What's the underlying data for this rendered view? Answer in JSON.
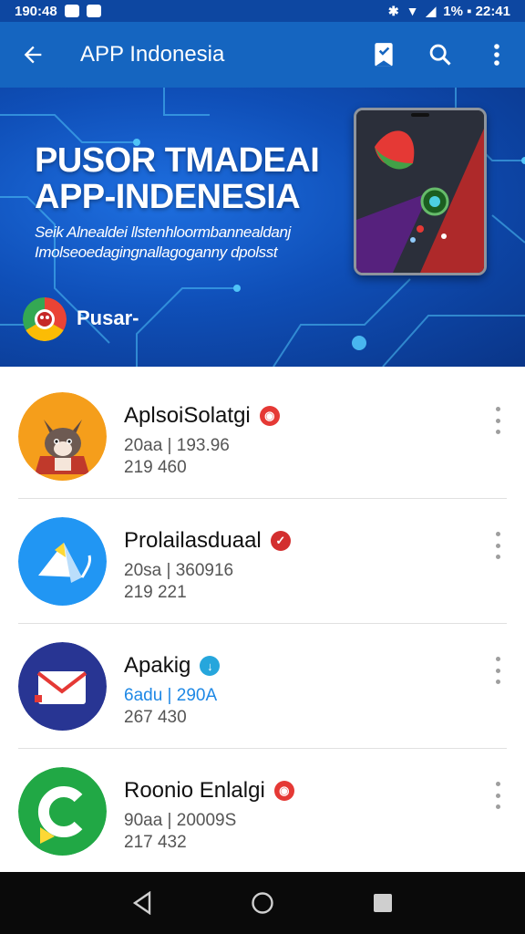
{
  "status_bar": {
    "time": "190:48",
    "right_text": "1% ▪ 22:41"
  },
  "app_bar": {
    "title": "APP Indonesia",
    "icons": [
      "back-arrow-icon",
      "bookmark-icon",
      "search-icon",
      "more-vert-icon"
    ]
  },
  "banner": {
    "title": "PUSOR TMADEAI\nAPP-INDENESIA",
    "subtitle": "Seik Alnealdei llstenhloormbannealdanj\nImolseoedagingnallagoganny dpolsst",
    "brand": "Pusar-"
  },
  "apps": [
    {
      "name": "AplsoiSolatgi",
      "meta1": "20aa | 193.96",
      "meta2": "219 460",
      "badge_color": "#e53935",
      "badge_glyph": "◉",
      "icon": "fox-mascot-icon"
    },
    {
      "name": "Prolailasduaal",
      "meta1": "20sa | 360916",
      "meta2": "219 221",
      "badge_color": "#d32f2f",
      "badge_glyph": "✓",
      "icon": "paper-plane-icon"
    },
    {
      "name": "Apakig",
      "meta1": "6adu | 290A",
      "meta2": "267 430",
      "badge_color": "#1e88e5",
      "badge_glyph": "↓",
      "icon": "mail-icon"
    },
    {
      "name": "Roonio Enlalgi",
      "meta1": "90aa | 20009S",
      "meta2": "217 432",
      "badge_color": "#e53935",
      "badge_glyph": "◉",
      "icon": "refresh-c-icon"
    }
  ],
  "colors": {
    "app_bar": "#1565c0",
    "status_bar": "#0d47a1",
    "apps_meta_highlight": "#1e88e5"
  },
  "nav": {
    "icons": [
      "back-triangle-icon",
      "home-circle-icon",
      "recents-square-icon"
    ]
  }
}
